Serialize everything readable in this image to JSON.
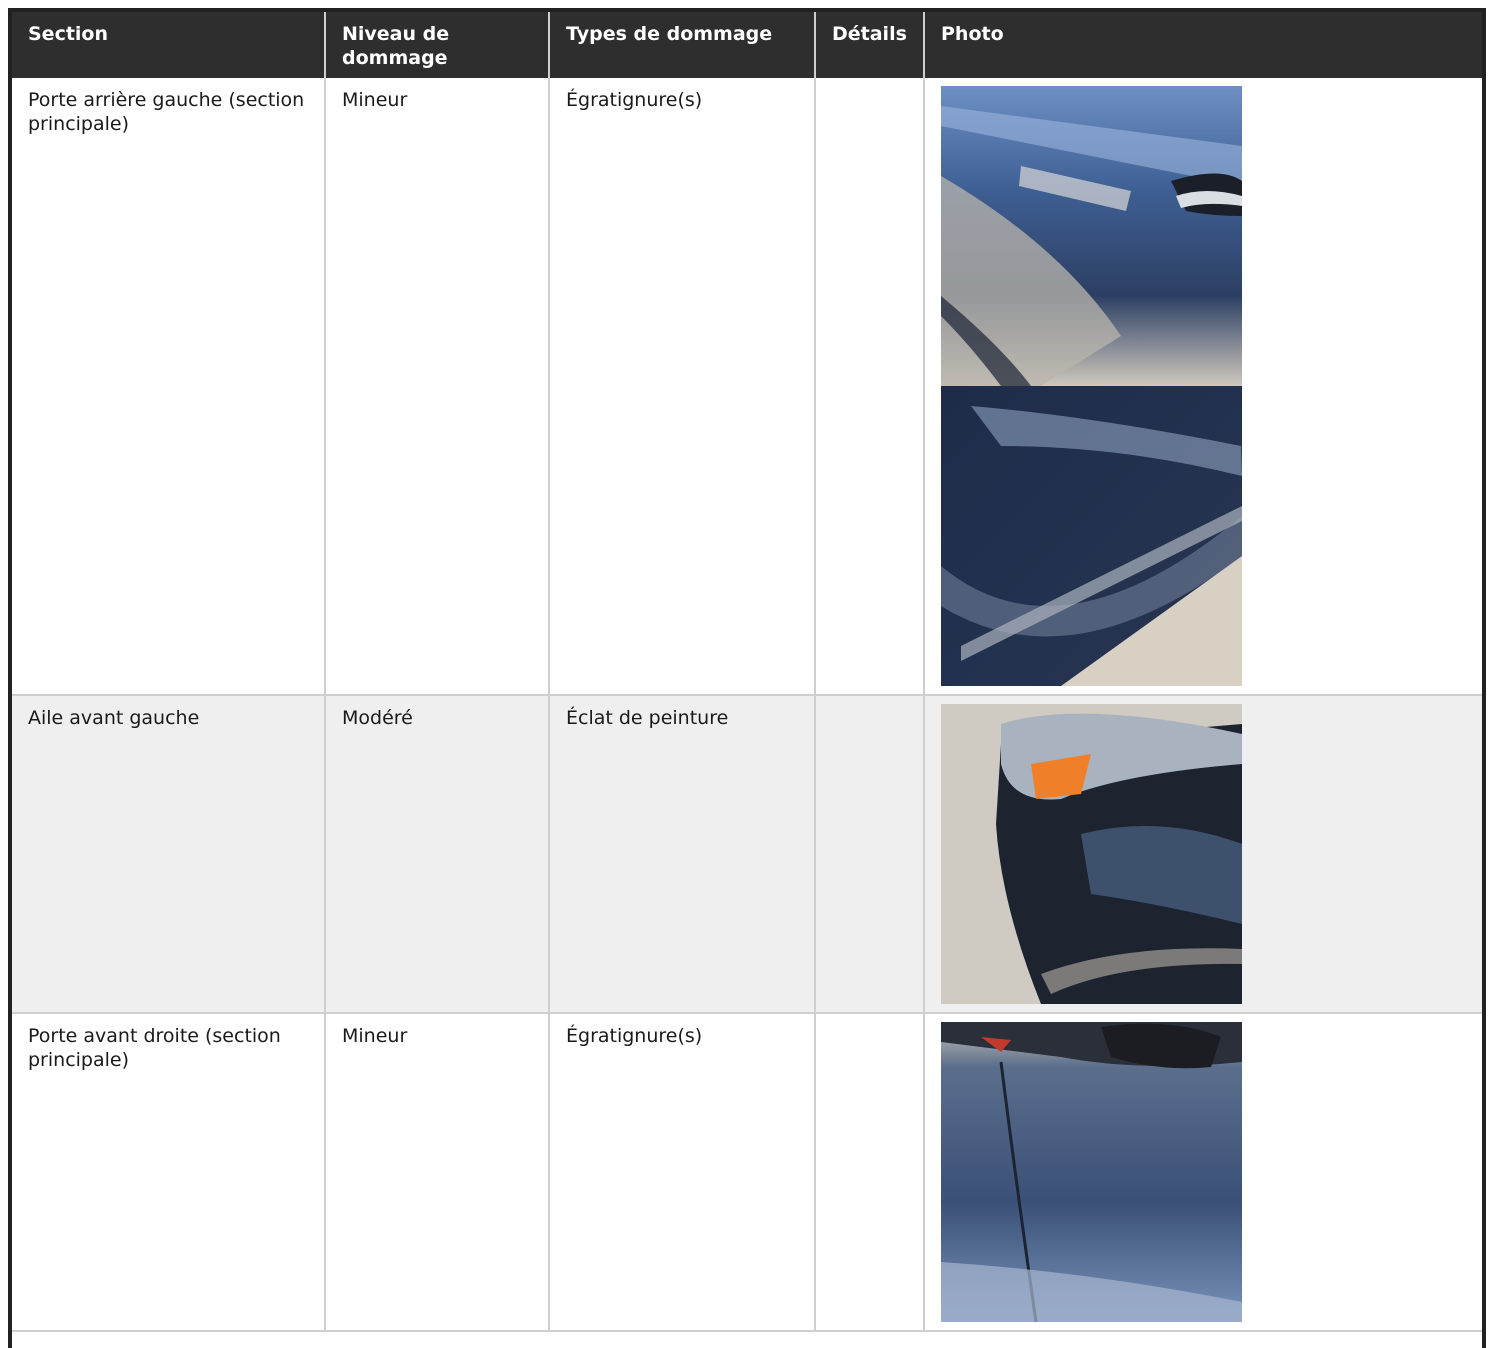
{
  "table": {
    "headers": [
      "Section",
      "Niveau de dommage",
      "Types de dommage",
      "Détails",
      "Photo"
    ],
    "rows": [
      {
        "section": "Porte arrière gauche (section principale)",
        "niveau": "Mineur",
        "types": "Égratignure(s)",
        "details": "",
        "photos": [
          "rear-left-door-photo-1",
          "rear-left-door-photo-2"
        ]
      },
      {
        "section": "Aile avant gauche",
        "niveau": "Modéré",
        "types": "Éclat de peinture",
        "details": "",
        "photos": [
          "front-left-fender-photo"
        ]
      },
      {
        "section": "Porte avant droite (section principale)",
        "niveau": "Mineur",
        "types": "Égratignure(s)",
        "details": "",
        "photos": [
          "front-right-door-photo"
        ]
      }
    ]
  },
  "colors": {
    "header_bg": "#2e2e2e",
    "header_text": "#ffffff",
    "alt_row_bg": "#efefef",
    "border": "#cfcfcf"
  }
}
